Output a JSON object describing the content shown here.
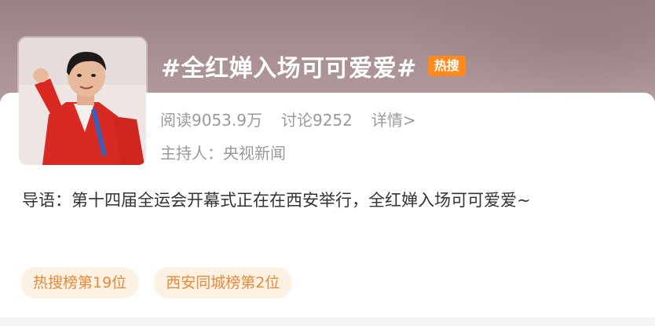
{
  "topic": {
    "title": "#全红婵入场可可爱爱#",
    "badge": "热搜",
    "stats": {
      "reads": "阅读9053.9万",
      "discussions": "讨论9252",
      "details": "详情>"
    },
    "host": "主持人：央视新闻",
    "intro": "导语：第十四届全运会开幕式正在在西安举行，全红婵入场可可爱爱~",
    "tags": [
      "热搜榜第19位",
      "西安同城榜第2位"
    ]
  },
  "colors": {
    "badge": "#ff8a1c",
    "tag_bg": "#fdf1e4",
    "tag_text": "#e88a3a",
    "meta_text": "#9a9a9a"
  },
  "icons": {
    "avatar": "topic-avatar-photo"
  }
}
